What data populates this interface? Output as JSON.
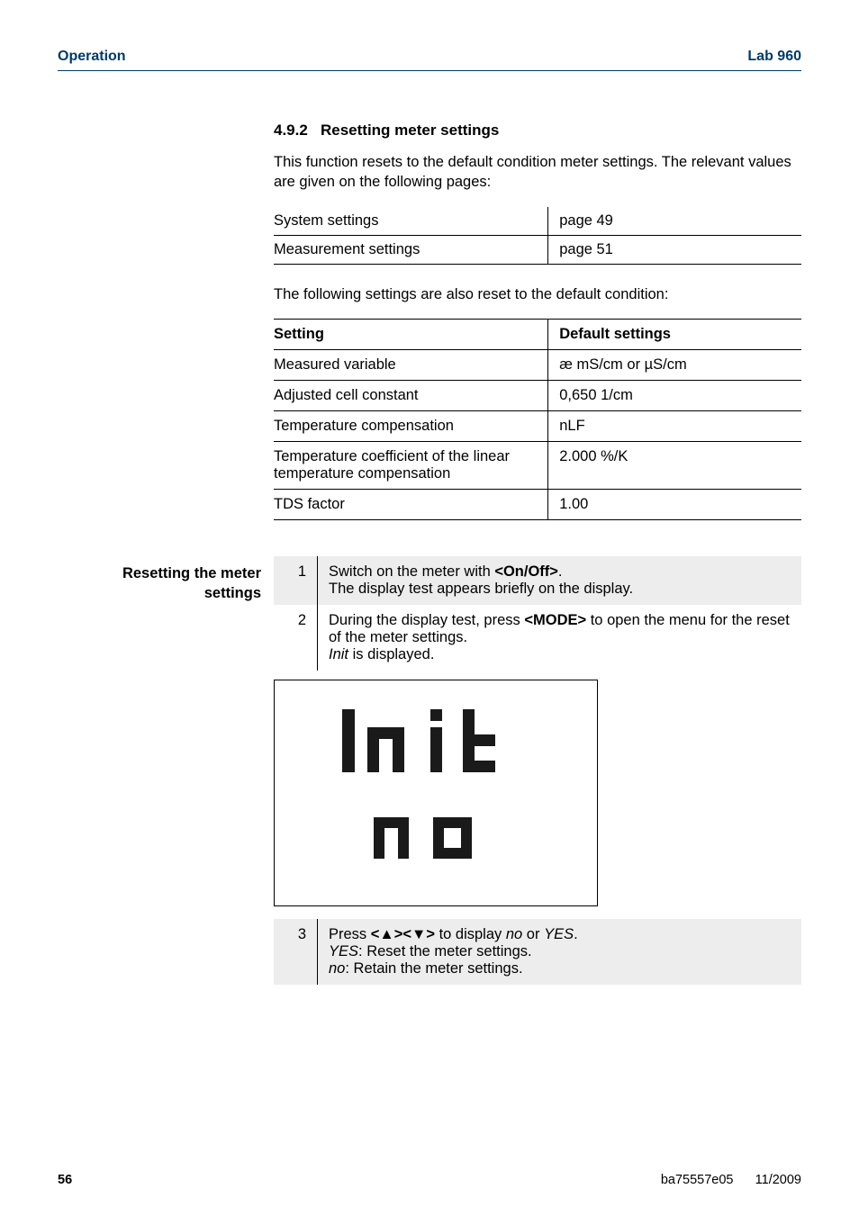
{
  "header": {
    "left": "Operation",
    "right": "Lab 960"
  },
  "section": {
    "num": "4.9.2",
    "title": "Resetting meter settings"
  },
  "intro": "This function resets to the default condition meter settings. The relevant values are given on the following pages:",
  "pageRefs": [
    {
      "label": "System settings",
      "page": "page 49"
    },
    {
      "label": "Measurement settings",
      "page": "page 51"
    }
  ],
  "defaultsIntro": "The following settings are also reset to the default condition:",
  "settingsTable": {
    "headers": [
      "Setting",
      "Default settings"
    ],
    "rows": [
      [
        "Measured variable",
        "æ mS/cm or µS/cm"
      ],
      [
        "Adjusted cell constant",
        "0,650 1/cm"
      ],
      [
        "Temperature compensation",
        "nLF"
      ],
      [
        "Temperature coefficient of the linear temperature compensation",
        "2.000 %/K"
      ],
      [
        "TDS factor",
        "1.00"
      ]
    ]
  },
  "sideLabel": {
    "line1": "Resetting the meter",
    "line2": "settings"
  },
  "steps": [
    {
      "num": "1",
      "shaded": true,
      "parts": [
        {
          "t": "Switch on the meter with "
        },
        {
          "t": "<On/Off>",
          "b": true
        },
        {
          "t": ".\nThe display test appears briefly on the display."
        }
      ]
    },
    {
      "num": "2",
      "shaded": false,
      "parts": [
        {
          "t": "During the display test, press "
        },
        {
          "t": "<MODE>",
          "b": true
        },
        {
          "t": " to open the menu for the reset of the meter settings.\n"
        },
        {
          "t": "Init",
          "i": true
        },
        {
          "t": " is displayed."
        }
      ]
    },
    {
      "num": "3",
      "shaded": true,
      "parts": [
        {
          "t": "Press "
        },
        {
          "t": "<▲><▼>",
          "b": true
        },
        {
          "t": " to display "
        },
        {
          "t": "no",
          "i": true
        },
        {
          "t": " or "
        },
        {
          "t": "YES",
          "i": true
        },
        {
          "t": ".\n"
        },
        {
          "t": "YES",
          "i": true
        },
        {
          "t": ": Reset the meter settings.\n"
        },
        {
          "t": "no",
          "i": true
        },
        {
          "t": ": Retain the meter settings."
        }
      ]
    }
  ],
  "footer": {
    "page": "56",
    "doc": "ba75557e05",
    "date": "11/2009"
  }
}
